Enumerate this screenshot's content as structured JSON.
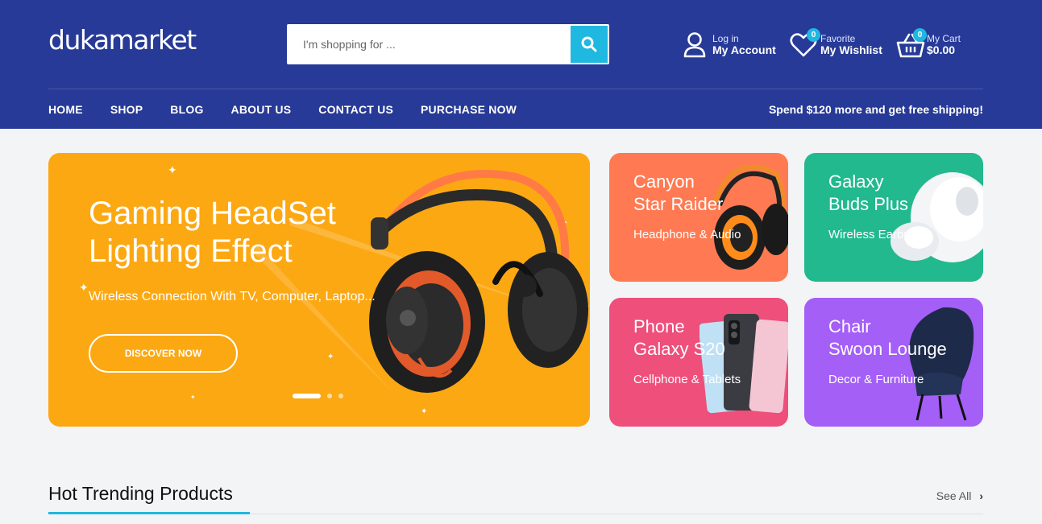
{
  "brand": {
    "logo_text": "dukamarket"
  },
  "search": {
    "placeholder": "I'm shopping for ..."
  },
  "account": {
    "small": "Log in",
    "big": "My Account"
  },
  "wishlist": {
    "small": "Favorite",
    "big": "My Wishlist",
    "count": "0"
  },
  "cart": {
    "small": "My Cart",
    "big": "$0.00",
    "count": "0"
  },
  "nav": {
    "items": [
      "HOME",
      "SHOP",
      "BLOG",
      "ABOUT US",
      "CONTACT US",
      "PURCHASE NOW"
    ]
  },
  "promo_text": "Spend $120 more and get free shipping!",
  "hero": {
    "title_line1": "Gaming HeadSet",
    "title_line2": "Lighting Effect",
    "subtitle": "Wireless Connection With TV, Computer, Laptop...",
    "button": "DISCOVER NOW",
    "bg_color": "#fca813"
  },
  "cards": [
    {
      "title_line1": "Canyon",
      "title_line2": "Star Raider",
      "subtitle": "Headphone & Audio",
      "color": "#ff7a52"
    },
    {
      "title_line1": "Galaxy",
      "title_line2": "Buds Plus",
      "subtitle": "Wireless Earbuds",
      "color": "#22b98f"
    },
    {
      "title_line1": "Phone",
      "title_line2": "Galaxy S20",
      "subtitle": "Cellphone & Tablets",
      "color": "#ee4f7b"
    },
    {
      "title_line1": "Chair",
      "title_line2": "Swoon Lounge",
      "subtitle": "Decor & Furniture",
      "color": "#a45ff6"
    }
  ],
  "section": {
    "title": "Hot Trending Products",
    "see_all": "See All"
  },
  "colors": {
    "header": "#273a97",
    "accent": "#1fb8e0"
  }
}
